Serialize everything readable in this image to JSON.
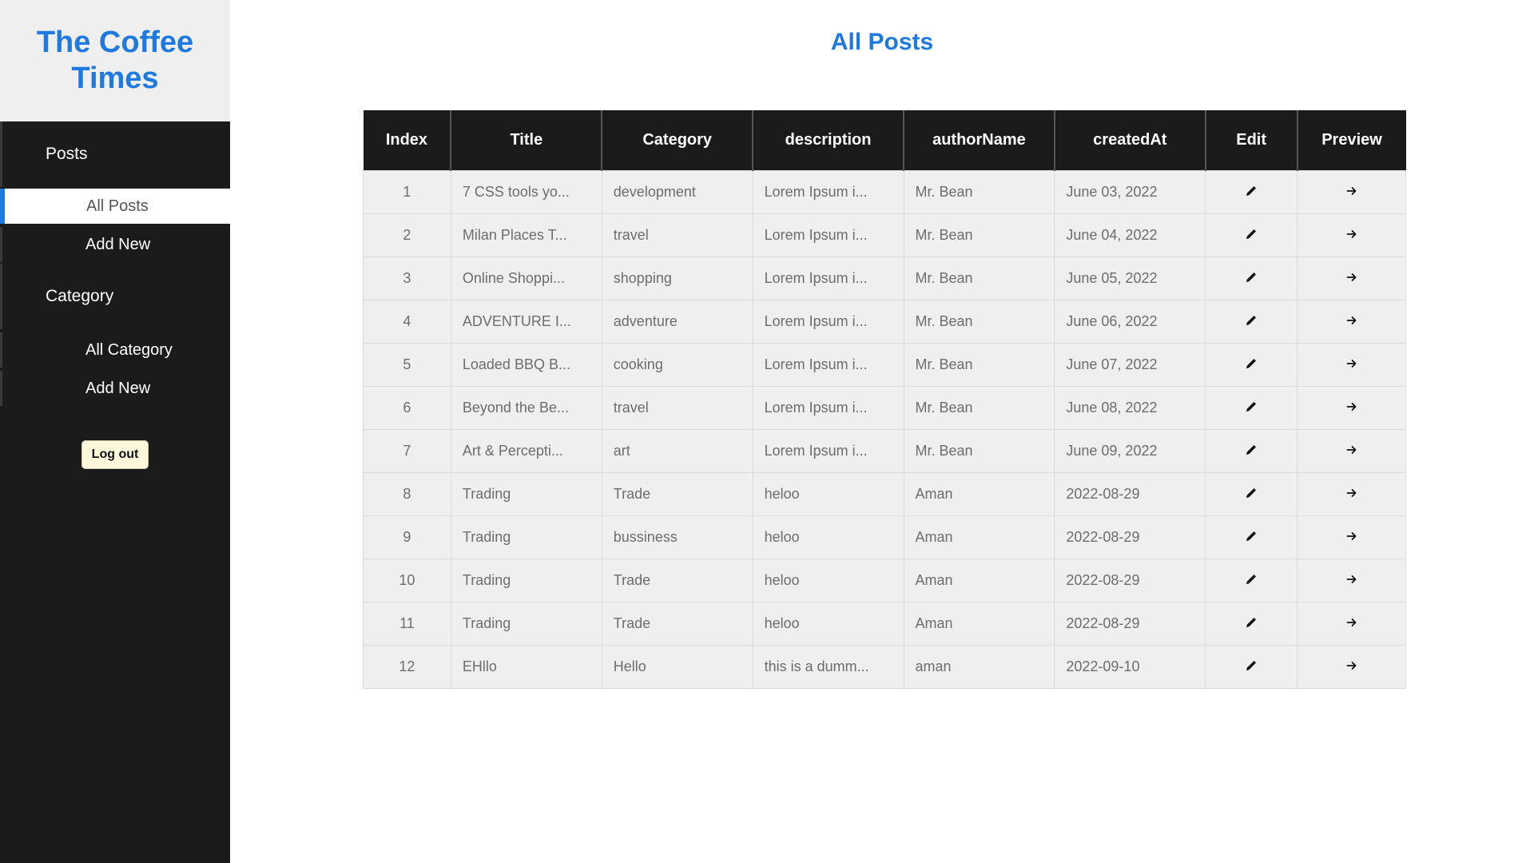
{
  "brand": {
    "title": "The Coffee Times"
  },
  "sidebar": {
    "posts_heading": "Posts",
    "posts_items": [
      {
        "label": "All Posts",
        "active": true
      },
      {
        "label": "Add New",
        "active": false
      }
    ],
    "category_heading": "Category",
    "category_items": [
      {
        "label": "All Category",
        "active": false
      },
      {
        "label": "Add New",
        "active": false
      }
    ],
    "logout_label": "Log out"
  },
  "page": {
    "title": "All Posts"
  },
  "table": {
    "headers": [
      "Index",
      "Title",
      "Category",
      "description",
      "authorName",
      "createdAt",
      "Edit",
      "Preview"
    ],
    "rows": [
      {
        "index": "1",
        "title": "7 CSS tools yo...",
        "category": "development",
        "description": "Lorem Ipsum i...",
        "author": "Mr. Bean",
        "created": "June 03, 2022"
      },
      {
        "index": "2",
        "title": "Milan Places T...",
        "category": "travel",
        "description": "Lorem Ipsum i...",
        "author": "Mr. Bean",
        "created": "June 04, 2022"
      },
      {
        "index": "3",
        "title": "Online Shoppi...",
        "category": "shopping",
        "description": "Lorem Ipsum i...",
        "author": "Mr. Bean",
        "created": "June 05, 2022"
      },
      {
        "index": "4",
        "title": "ADVENTURE I...",
        "category": "adventure",
        "description": "Lorem Ipsum i...",
        "author": "Mr. Bean",
        "created": "June 06, 2022"
      },
      {
        "index": "5",
        "title": "Loaded BBQ B...",
        "category": "cooking",
        "description": "Lorem Ipsum i...",
        "author": "Mr. Bean",
        "created": "June 07, 2022"
      },
      {
        "index": "6",
        "title": "Beyond the Be...",
        "category": "travel",
        "description": "Lorem Ipsum i...",
        "author": "Mr. Bean",
        "created": "June 08, 2022"
      },
      {
        "index": "7",
        "title": "Art & Percepti...",
        "category": "art",
        "description": "Lorem Ipsum i...",
        "author": "Mr. Bean",
        "created": "June 09, 2022"
      },
      {
        "index": "8",
        "title": "Trading",
        "category": "Trade",
        "description": "heloo",
        "author": "Aman",
        "created": "2022-08-29"
      },
      {
        "index": "9",
        "title": "Trading",
        "category": "bussiness",
        "description": "heloo",
        "author": "Aman",
        "created": "2022-08-29"
      },
      {
        "index": "10",
        "title": "Trading",
        "category": "Trade",
        "description": "heloo",
        "author": "Aman",
        "created": "2022-08-29"
      },
      {
        "index": "11",
        "title": "Trading",
        "category": "Trade",
        "description": "heloo",
        "author": "Aman",
        "created": "2022-08-29"
      },
      {
        "index": "12",
        "title": "EHllo",
        "category": "Hello",
        "description": "this is a dumm...",
        "author": "aman",
        "created": "2022-09-10"
      }
    ]
  },
  "icons": {
    "edit": "pencil-icon",
    "preview": "arrow-right-icon"
  },
  "colors": {
    "accent": "#1f7ae0",
    "sidebar_bg": "#1b1b1b",
    "brand_bg": "#efefef",
    "row_bg": "#efefef",
    "logout_bg": "#fdf8dc"
  }
}
